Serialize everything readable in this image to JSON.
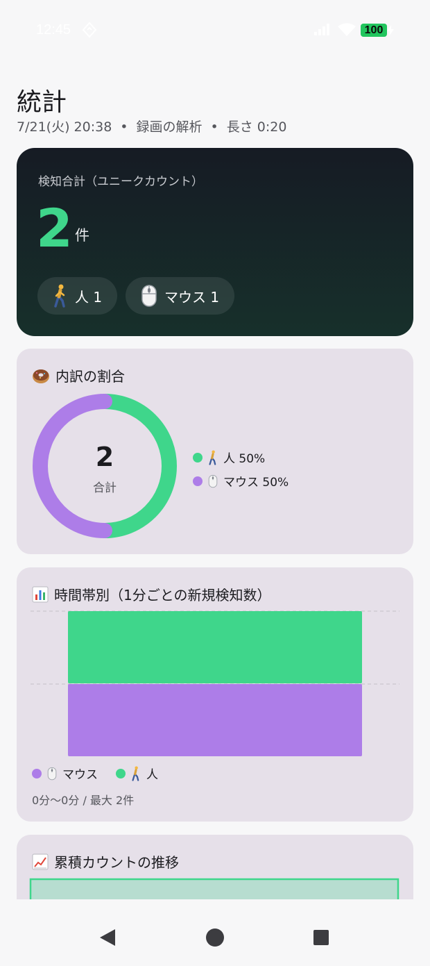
{
  "status_bar": {
    "time": "12:45",
    "battery": "100"
  },
  "header": {
    "title": "統計",
    "date": "7/21(火) 20:38",
    "source": "録画の解析",
    "duration": "長さ 0:20",
    "separator": "•"
  },
  "summary": {
    "label": "検知合計（ユニークカウント）",
    "count": "2",
    "unit": "件",
    "chips": [
      {
        "icon": "person-walking-icon",
        "label": "人 1"
      },
      {
        "icon": "mouse-icon",
        "label": "マウス 1"
      }
    ]
  },
  "breakdown": {
    "title_icon": "donut-icon",
    "title": "内訳の割合",
    "center_value": "2",
    "center_label": "合計",
    "legend": [
      {
        "label": "人 50%",
        "icon": "person-walking-icon",
        "color": "#3fd68b"
      },
      {
        "label": "マウス 50%",
        "icon": "mouse-icon",
        "color": "#ad7de8"
      }
    ]
  },
  "hourly": {
    "title_icon": "bar-chart-icon",
    "title": "時間帯別（1分ごとの新規検知数）",
    "legend": [
      {
        "label": "マウス",
        "icon": "mouse-icon",
        "color": "#ad7de8"
      },
      {
        "label": "人",
        "icon": "person-walking-icon",
        "color": "#3fd68b"
      }
    ],
    "footer": "0分〜0分 / 最大 2件"
  },
  "cumulative": {
    "title_icon": "trend-chart-icon",
    "title": "累積カウントの推移"
  },
  "colors": {
    "person": "#3fd68b",
    "mouse": "#ad7de8",
    "card_bg": "#e6e0e9"
  },
  "chart_data": [
    {
      "type": "pie",
      "categories": [
        "人",
        "マウス"
      ],
      "values": [
        1,
        1
      ],
      "percent": [
        50,
        50
      ],
      "center_value": 2
    },
    {
      "type": "bar",
      "stacked": true,
      "categories": [
        "0分"
      ],
      "series": [
        {
          "name": "マウス",
          "values": [
            1
          ]
        },
        {
          "name": "人",
          "values": [
            1
          ]
        }
      ],
      "ylim": [
        0,
        2
      ],
      "grid": true
    }
  ]
}
